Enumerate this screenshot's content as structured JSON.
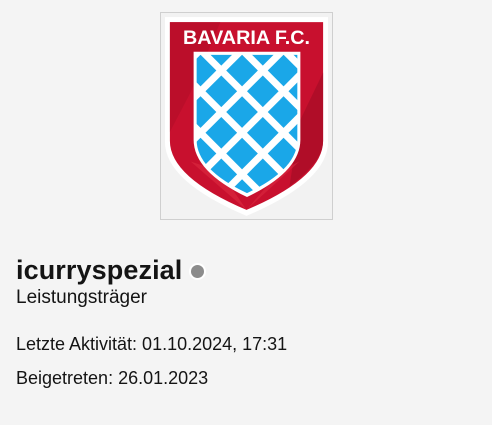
{
  "profile": {
    "avatar": {
      "logo_text": "BAVARIA F.C.",
      "colors": {
        "shield_red": "#c8102e",
        "shield_red_dark": "#a00c24",
        "diamond_blue": "#1aa7e8",
        "white": "#ffffff"
      }
    },
    "username": "icurryspezial",
    "status_icon": "offline-status-dot",
    "user_title": "Leistungsträger",
    "last_activity": "Letzte Aktivität: 01.10.2024, 17:31",
    "joined": "Beigetreten: 26.01.2023"
  }
}
